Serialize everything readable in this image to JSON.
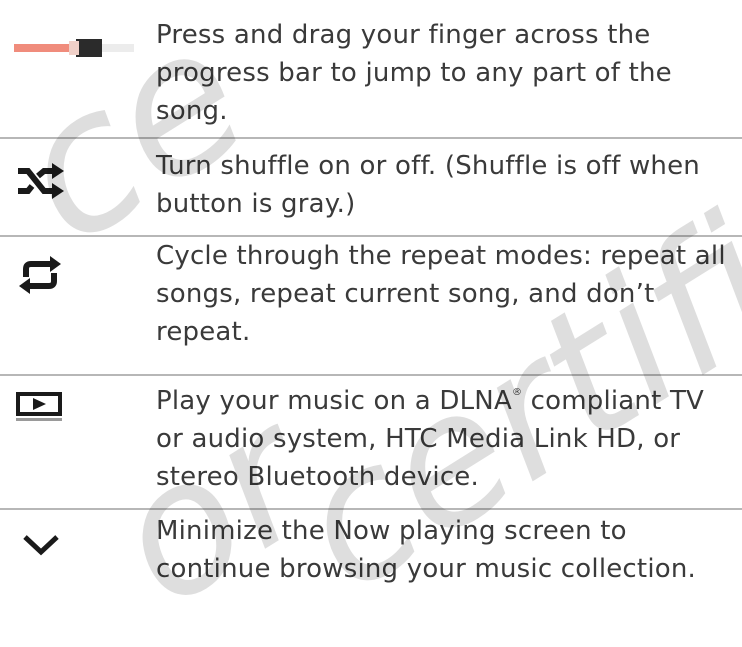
{
  "rows": [
    {
      "icon": "progress-bar-icon",
      "line1": "Press and drag your finger across the",
      "line2": "progress bar to jump to any part of the",
      "line3": "song."
    },
    {
      "icon": "shuffle-icon",
      "line1": "Turn shuffle on or off. (Shuffle is off when",
      "line2": "button is gray.)"
    },
    {
      "icon": "repeat-icon",
      "line1": "Cycle through the repeat modes: repeat all",
      "line2": "songs, repeat current song, and don’t",
      "line3": "repeat."
    },
    {
      "icon": "play-on-tv-icon",
      "line1a": "Play your music on a DLNA",
      "line1_sup": "®",
      "line1b": " compliant TV",
      "line2": "or audio system, HTC Media Link HD, or",
      "line3": "stereo Bluetooth device."
    },
    {
      "icon": "chevron-down-icon",
      "line1": "Minimize the Now playing screen to",
      "line2": "continue browsing your music collection."
    }
  ],
  "watermark": {
    "text1": "ce",
    "text2": "certific",
    "text3": "or"
  },
  "colors": {
    "text": "#3a3a3a",
    "divider": "#b7b7b7",
    "progress_played": "#f08c7c",
    "progress_thumb": "#2b2b2b"
  }
}
